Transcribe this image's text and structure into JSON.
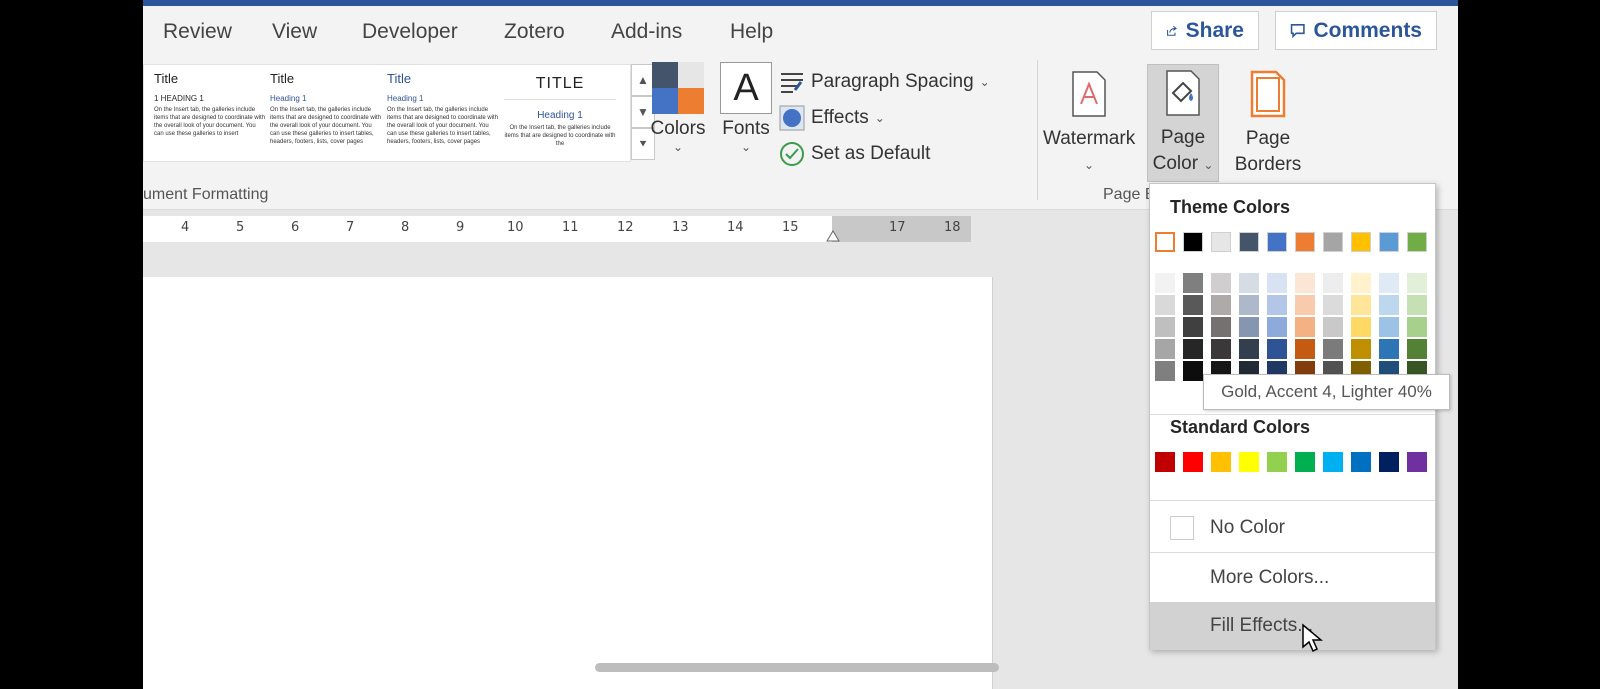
{
  "tabs": [
    "Review",
    "View",
    "Developer",
    "Zotero",
    "Add-ins",
    "Help"
  ],
  "share_label": "Share",
  "comments_label": "Comments",
  "gallery": {
    "styles": [
      {
        "title": "Title",
        "heading": "1   HEADING 1",
        "body": "On the Insert tab, the galleries include items that are designed to coordinate with the overall look of your document. You can use these galleries to insert"
      },
      {
        "title": "Title",
        "heading": "Heading 1",
        "body": "On the Insert tab, the galleries include items that are designed to coordinate with the overall look of your document. You can use these galleries to insert tables, headers, footers, lists, cover pages"
      },
      {
        "title": "Title",
        "heading": "Heading 1",
        "body": "On the Insert tab, the galleries include items that are designed to coordinate with the overall look of your document. You can use these galleries to insert tables, headers, footers, lists, cover pages"
      },
      {
        "title": "TITLE",
        "heading": "Heading 1",
        "body": "On the Insert tab, the galleries include items that are designed to coordinate with the"
      }
    ]
  },
  "colors_label": "Colors",
  "fonts_label": "Fonts",
  "fonts_glyph": "A",
  "paragraph_spacing_label": "Paragraph Spacing",
  "effects_label": "Effects",
  "set_default_label": "Set as Default",
  "group_doc_formatting": "ument Formatting",
  "watermark_label": "Watermark",
  "page_color_label_1": "Page",
  "page_color_label_2": "Color",
  "page_borders_label_1": "Page",
  "page_borders_label_2": "Borders",
  "group_page_bg": "Page B",
  "ruler_numbers": [
    "4",
    "5",
    "6",
    "7",
    "8",
    "9",
    "10",
    "11",
    "12",
    "13",
    "14",
    "15",
    "17",
    "18"
  ],
  "dropdown": {
    "theme_heading": "Theme Colors",
    "standard_heading": "Standard Colors",
    "no_color": "No Color",
    "more_colors": "More Colors...",
    "fill_effects": "Fill Effects...",
    "theme_colors": [
      "#ffffff",
      "#000000",
      "#e7e6e6",
      "#44546a",
      "#4472c4",
      "#ed7d31",
      "#a5a5a5",
      "#ffc000",
      "#5b9bd5",
      "#70ad47"
    ],
    "theme_shades": [
      [
        "#f2f2f2",
        "#d9d9d9",
        "#bfbfbf",
        "#a6a6a6",
        "#7f7f7f"
      ],
      [
        "#7f7f7f",
        "#595959",
        "#404040",
        "#262626",
        "#0d0d0d"
      ],
      [
        "#d0cece",
        "#aeaaaa",
        "#767171",
        "#3a3838",
        "#171616"
      ],
      [
        "#d6dce4",
        "#adb9ca",
        "#8496b0",
        "#333f4f",
        "#222a35"
      ],
      [
        "#d9e2f3",
        "#b4c6e7",
        "#8eaadb",
        "#2f5496",
        "#1f3864"
      ],
      [
        "#fbe5d5",
        "#f7cbac",
        "#f4b183",
        "#c55a11",
        "#833c0b"
      ],
      [
        "#ededed",
        "#dbdbdb",
        "#c9c9c9",
        "#7b7b7b",
        "#525252"
      ],
      [
        "#fff2cc",
        "#fee599",
        "#ffd965",
        "#bf8f00",
        "#7f6000"
      ],
      [
        "#deebf6",
        "#bdd7ee",
        "#9cc3e5",
        "#2e75b5",
        "#1e4e79"
      ],
      [
        "#e2efd9",
        "#c5e0b3",
        "#a8d08d",
        "#538135",
        "#375623"
      ]
    ],
    "standard_colors": [
      "#c00000",
      "#ff0000",
      "#ffc000",
      "#ffff00",
      "#92d050",
      "#00b050",
      "#00b0f0",
      "#0070c0",
      "#002060",
      "#7030a0"
    ]
  },
  "tooltip": "Gold, Accent 4, Lighter 40%"
}
